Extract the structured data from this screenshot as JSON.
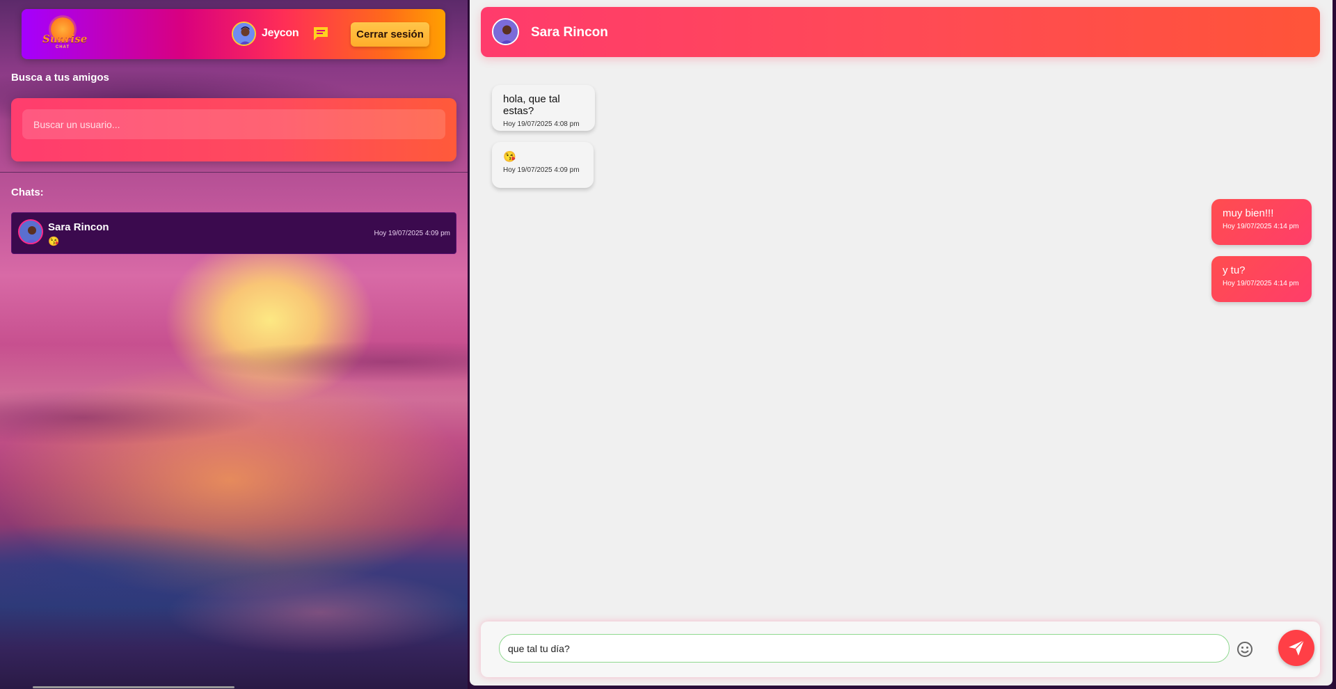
{
  "app": {
    "logo_text": "Sunrise",
    "logo_sub": "CHAT"
  },
  "user": {
    "name": "Jeycon",
    "logout_label": "Cerrar sesión"
  },
  "search": {
    "title": "Busca a tus amigos",
    "placeholder": "Buscar un usuario..."
  },
  "chats": {
    "title": "Chats:",
    "items": [
      {
        "name": "Sara Rincon",
        "last_message": "😘",
        "time": "Hoy 19/07/2025 4:09 pm"
      }
    ]
  },
  "conversation": {
    "contact_name": "Sara Rincon",
    "messages": [
      {
        "direction": "in",
        "text": "hola, que tal estas?",
        "time": "Hoy 19/07/2025 4:08 pm"
      },
      {
        "direction": "in",
        "text": "😘",
        "time": "Hoy 19/07/2025 4:09 pm"
      },
      {
        "direction": "out",
        "text": "muy bien!!!",
        "time": "Hoy 19/07/2025 4:14 pm"
      },
      {
        "direction": "out",
        "text": "y tu?",
        "time": "Hoy 19/07/2025 4:14 pm"
      }
    ],
    "composer_value": "que tal tu día?"
  },
  "colors": {
    "accent": "#ff4a56",
    "topbar_start": "#a400ff",
    "topbar_end": "#ffa000",
    "chat_item_bg": "#3b0a4e"
  }
}
